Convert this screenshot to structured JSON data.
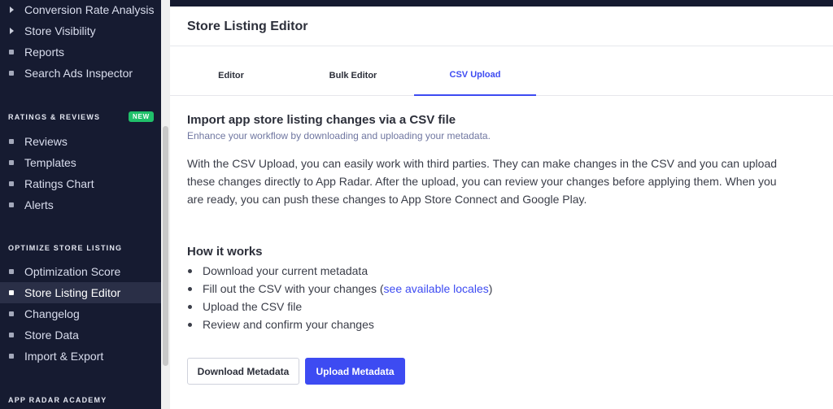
{
  "sidebar": {
    "top_items": [
      {
        "label": "Conversion Rate Analysis",
        "icon": "caret-right-icon"
      },
      {
        "label": "Store Visibility",
        "icon": "caret-right-icon"
      },
      {
        "label": "Reports",
        "icon": "bullet-icon"
      },
      {
        "label": "Search Ads Inspector",
        "icon": "bullet-icon"
      }
    ],
    "ratings_section": {
      "title": "RATINGS & REVIEWS",
      "badge": "NEW",
      "items": [
        "Reviews",
        "Templates",
        "Ratings Chart",
        "Alerts"
      ]
    },
    "optimize_section": {
      "title": "OPTIMIZE STORE LISTING",
      "items": [
        "Optimization Score",
        "Store Listing Editor",
        "Changelog",
        "Store Data",
        "Import & Export"
      ],
      "active_item": "Store Listing Editor"
    },
    "academy_section": {
      "title": "APP RADAR ACADEMY"
    }
  },
  "header": {
    "title": "Store Listing Editor"
  },
  "tabs": [
    {
      "label": "Editor",
      "active": false
    },
    {
      "label": "Bulk Editor",
      "active": false
    },
    {
      "label": "CSV Upload",
      "active": true
    }
  ],
  "content": {
    "heading": "Import app store listing changes via a CSV file",
    "subheading": "Enhance your workflow by downloading and uploading your metadata.",
    "paragraph": "With the CSV Upload, you can easily work with third parties. They can make changes in the CSV and you can upload these changes directly to App Radar. After the upload, you can review your changes before applying them. When you are ready, you can push these changes to App Store Connect and Google Play.",
    "how_title": "How it works",
    "steps": {
      "step1": "Download your current metadata",
      "step2_pre": "Fill out the CSV with your changes (",
      "step2_link": "see available locales",
      "step2_post": ")",
      "step3": "Upload the CSV file",
      "step4": "Review and confirm your changes"
    }
  },
  "buttons": {
    "download": "Download Metadata",
    "upload": "Upload Metadata"
  },
  "colors": {
    "accent": "#3d4bf2",
    "sidebar_bg": "#161b31",
    "badge_green": "#20c06a"
  }
}
